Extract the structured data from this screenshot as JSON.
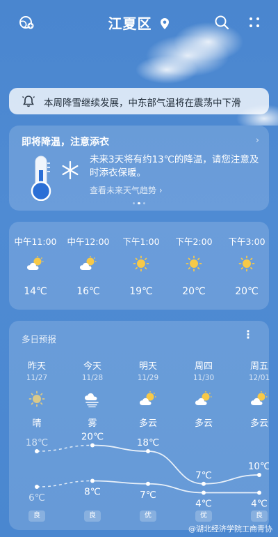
{
  "topbar": {
    "location": "江夏区",
    "icons": [
      "add-city-icon",
      "location-pin-icon",
      "search-icon",
      "more-icon"
    ]
  },
  "notice": {
    "text": "本周降雪继续发展，中东部气温将在震荡中下滑"
  },
  "alert": {
    "title": "即将降温，注意添衣",
    "body": "未来3天将有约13℃的降温，请您注意及时添衣保暖。",
    "link": "查看未来天气趋势"
  },
  "hourly": [
    {
      "time": "中午11:00",
      "icon": "partly-cloudy-icon",
      "temp": "14℃"
    },
    {
      "time": "中午12:00",
      "icon": "partly-cloudy-icon",
      "temp": "16℃"
    },
    {
      "time": "下午1:00",
      "icon": "sunny-icon",
      "temp": "19℃"
    },
    {
      "time": "下午2:00",
      "icon": "sunny-icon",
      "temp": "20℃"
    },
    {
      "time": "下午3:00",
      "icon": "sunny-icon",
      "temp": "20℃"
    }
  ],
  "daily": {
    "title": "多日预报",
    "days": [
      {
        "day": "昨天",
        "date": "11/27",
        "icon": "sunny-icon",
        "weather": "晴",
        "high": "18℃",
        "low": "6℃",
        "aqi": "良"
      },
      {
        "day": "今天",
        "date": "11/28",
        "icon": "fog-icon",
        "weather": "雾",
        "high": "20℃",
        "low": "8℃",
        "aqi": "良"
      },
      {
        "day": "明天",
        "date": "11/29",
        "icon": "partly-cloudy-icon",
        "weather": "多云",
        "high": "18℃",
        "low": "7℃",
        "aqi": "优"
      },
      {
        "day": "周四",
        "date": "11/30",
        "icon": "partly-cloudy-icon",
        "weather": "多云",
        "high": "7℃",
        "low": "4℃",
        "aqi": "优"
      },
      {
        "day": "周五",
        "date": "12/01",
        "icon": "partly-cloudy-icon",
        "weather": "多云",
        "high": "10℃",
        "low": "4℃",
        "aqi": "良"
      }
    ],
    "high_values": [
      18,
      20,
      18,
      7,
      10
    ],
    "low_values": [
      6,
      8,
      7,
      4,
      4
    ]
  },
  "watermark": "@湖北经济学院工商青协",
  "colors": {
    "background": "#4a86cf",
    "sun": "#f7c948",
    "cloud": "#ffffff"
  }
}
